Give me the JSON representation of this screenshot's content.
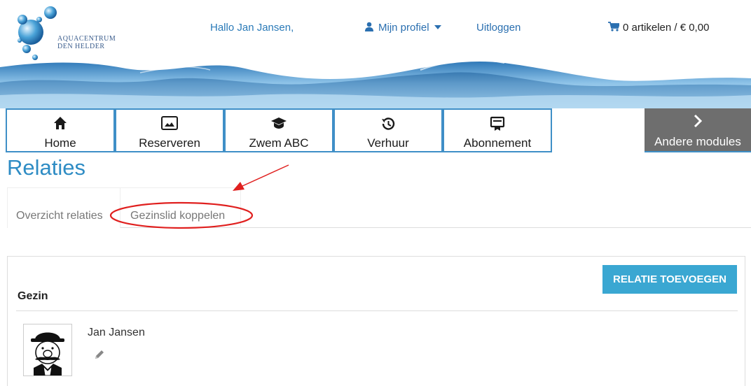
{
  "logo": {
    "line1": "Aquacentrum",
    "line2": "Den Helder"
  },
  "header": {
    "greeting": "Hallo Jan Jansen,",
    "profile": "Mijn profiel",
    "logout": "Uitloggen",
    "cart": "0 artikelen / € 0,00"
  },
  "nav": {
    "items": [
      {
        "label": "Home",
        "icon": "home-icon"
      },
      {
        "label": "Reserveren",
        "icon": "image-icon"
      },
      {
        "label": "Zwem ABC",
        "icon": "graduation-cap-icon"
      },
      {
        "label": "Verhuur",
        "icon": "history-icon"
      },
      {
        "label": "Abonnement",
        "icon": "certificate-icon"
      }
    ],
    "other": "Andere modules"
  },
  "page": {
    "title": "Relaties"
  },
  "tabs": [
    {
      "label": "Overzicht relaties"
    },
    {
      "label": "Gezinslid koppelen"
    }
  ],
  "panel": {
    "add_button": "RELATIE TOEVOEGEN",
    "section_title": "Gezin",
    "member_name": "Jan Jansen"
  },
  "colors": {
    "brand": "#2e8cc4",
    "nav_border": "#3f8fc7",
    "button": "#3aa7d2",
    "annotation": "#e0201f"
  }
}
